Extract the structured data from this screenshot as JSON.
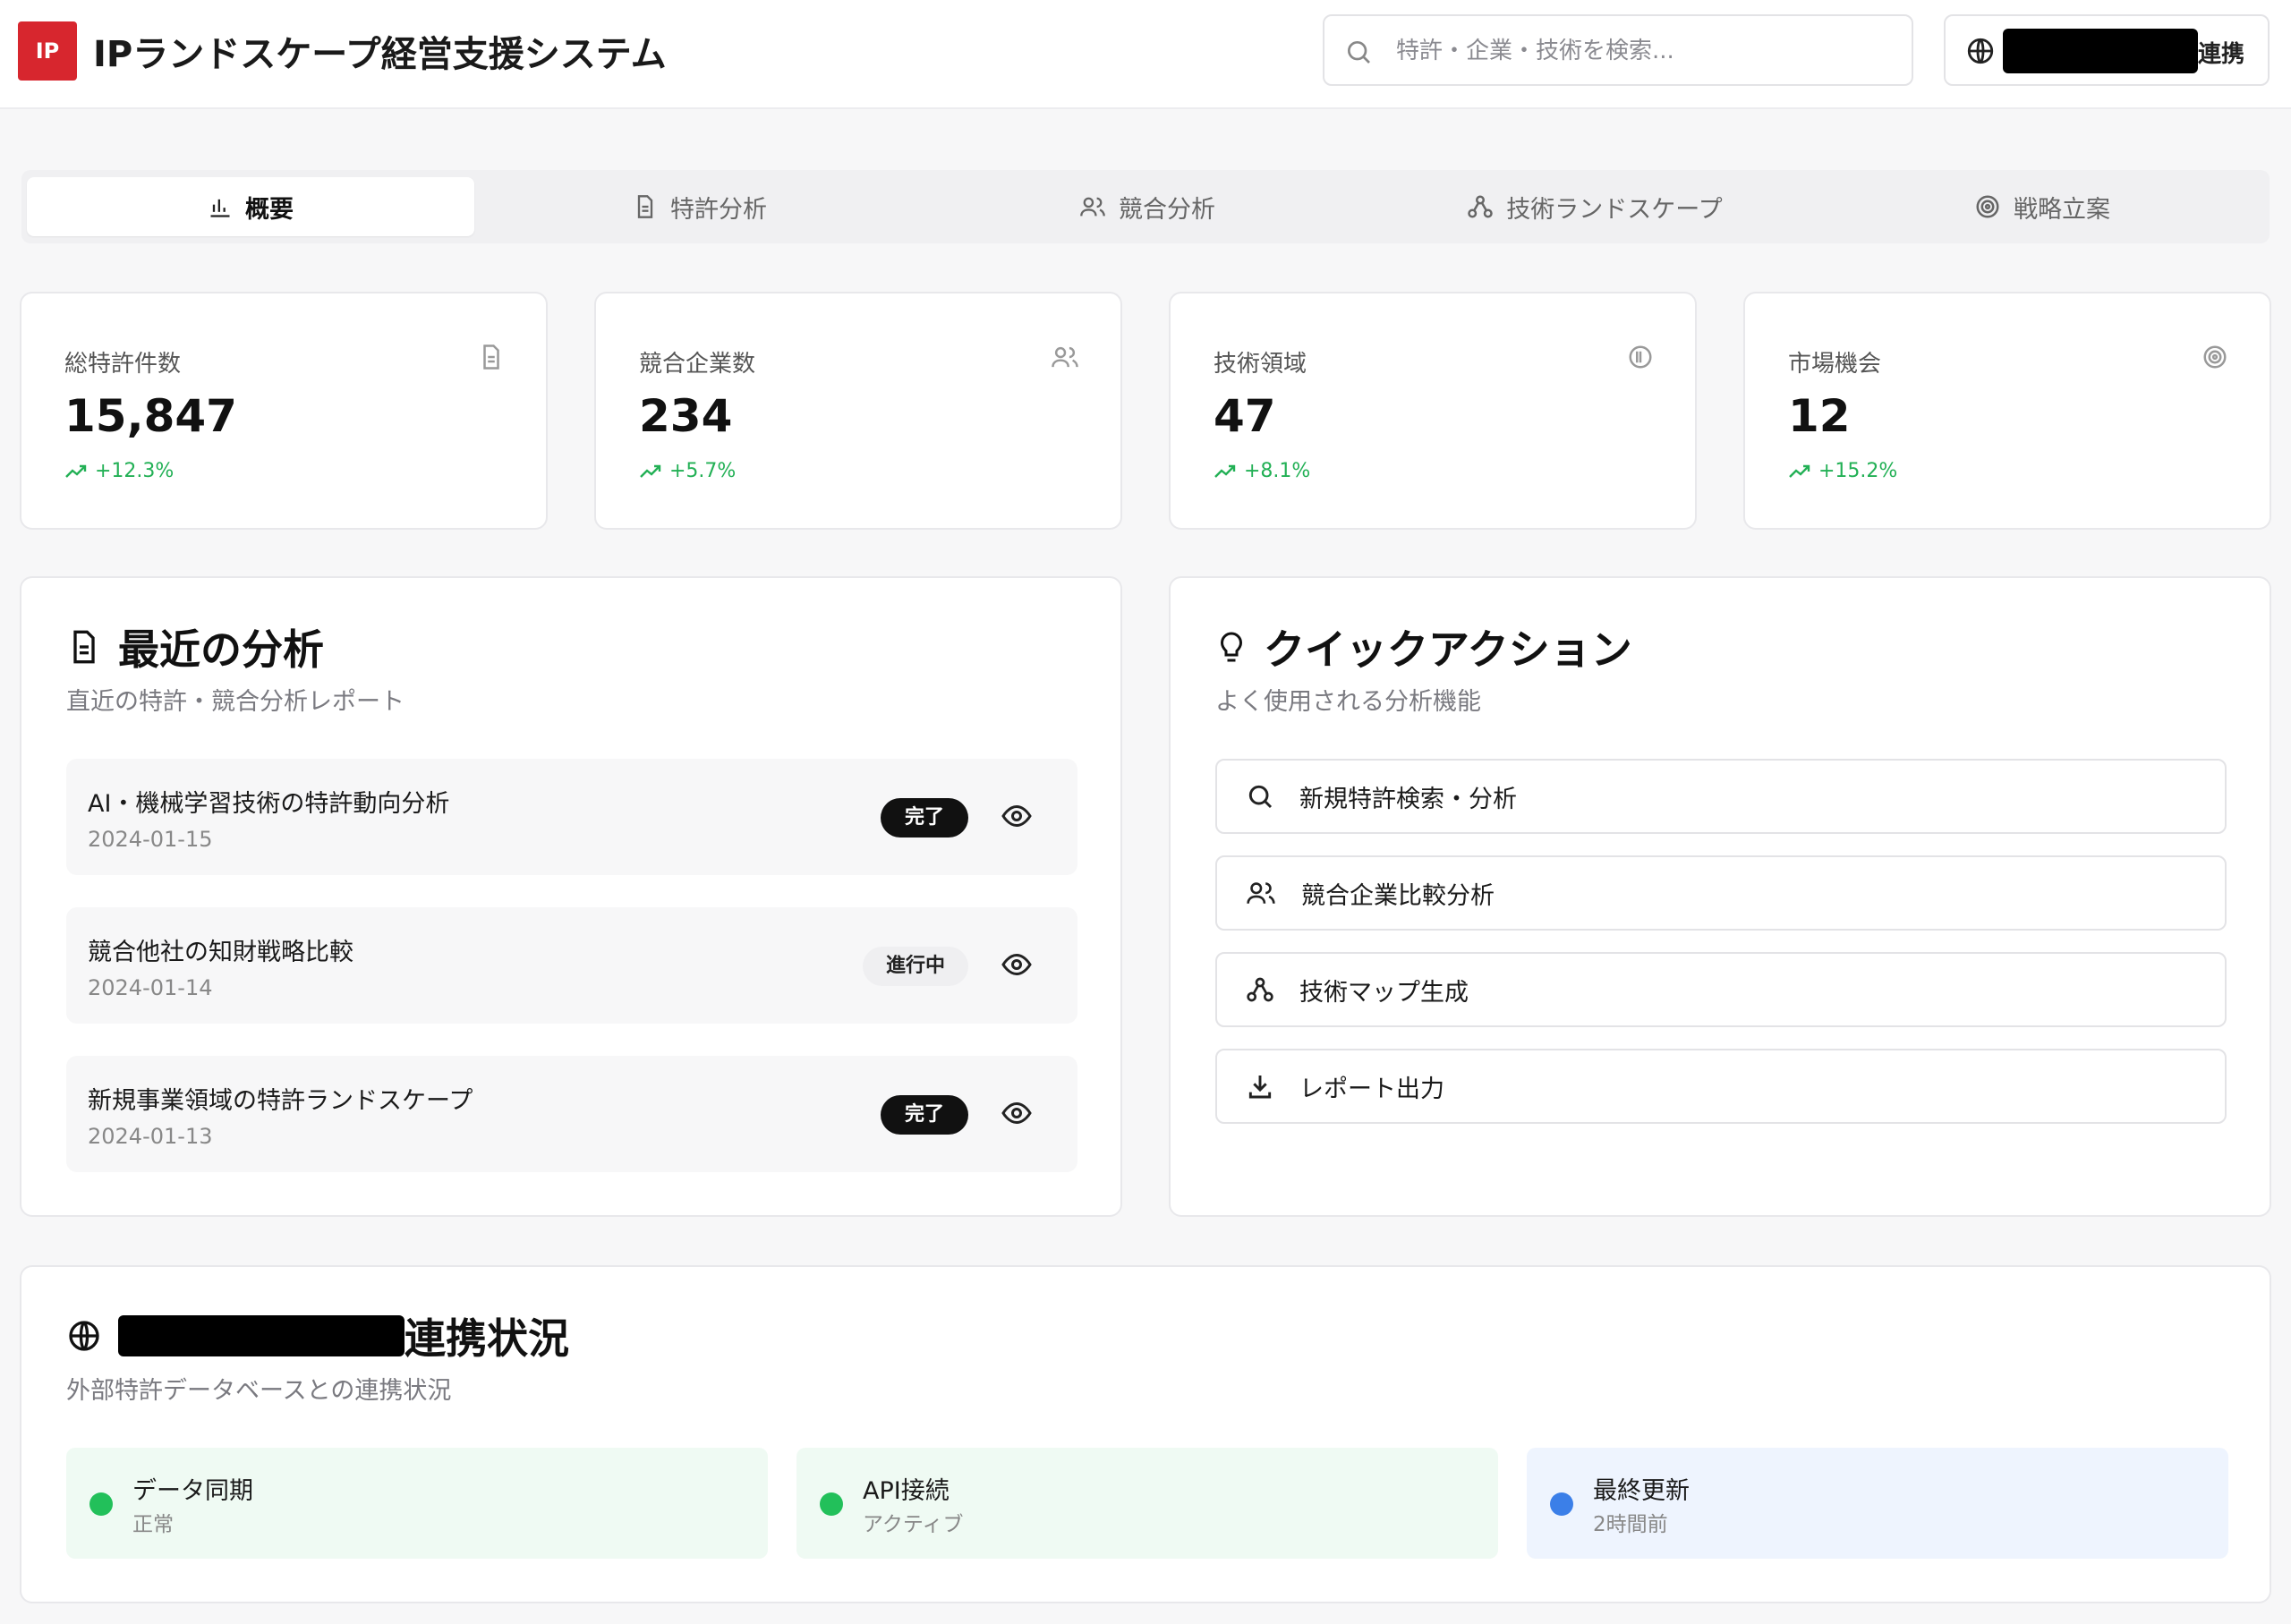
{
  "header": {
    "logo_text": "IP",
    "title": "IPランドスケープ経営支援システム",
    "search_placeholder": "特許・企業・技術を検索...",
    "connect_label": "連携"
  },
  "tabs": [
    {
      "label": "概要",
      "icon": "bar-chart-icon",
      "active": true
    },
    {
      "label": "特許分析",
      "icon": "document-icon",
      "active": false
    },
    {
      "label": "競合分析",
      "icon": "users-icon",
      "active": false
    },
    {
      "label": "技術ランドスケープ",
      "icon": "network-icon",
      "active": false
    },
    {
      "label": "戦略立案",
      "icon": "target-icon",
      "active": false
    }
  ],
  "stats": [
    {
      "label": "総特許件数",
      "value": "15,847",
      "trend": "+12.3%",
      "icon": "document-icon"
    },
    {
      "label": "競合企業数",
      "value": "234",
      "trend": "+5.7%",
      "icon": "users-icon"
    },
    {
      "label": "技術領域",
      "value": "47",
      "trend": "+8.1%",
      "icon": "info-icon"
    },
    {
      "label": "市場機会",
      "value": "12",
      "trend": "+15.2%",
      "icon": "target-icon"
    }
  ],
  "recent": {
    "title": "最近の分析",
    "subtitle": "直近の特許・競合分析レポート",
    "items": [
      {
        "name": "AI・機械学習技術の特許動向分析",
        "date": "2024-01-15",
        "status": "完了",
        "status_type": "done"
      },
      {
        "name": "競合他社の知財戦略比較",
        "date": "2024-01-14",
        "status": "進行中",
        "status_type": "progress"
      },
      {
        "name": "新規事業領域の特許ランドスケープ",
        "date": "2024-01-13",
        "status": "完了",
        "status_type": "done"
      }
    ]
  },
  "quick": {
    "title": "クイックアクション",
    "subtitle": "よく使用される分析機能",
    "actions": [
      {
        "label": "新規特許検索・分析",
        "icon": "search-icon"
      },
      {
        "label": "競合企業比較分析",
        "icon": "users-icon"
      },
      {
        "label": "技術マップ生成",
        "icon": "network-icon"
      },
      {
        "label": "レポート出力",
        "icon": "download-icon"
      }
    ]
  },
  "integration": {
    "title_suffix": "連携状況",
    "subtitle": "外部特許データベースとの連携状況",
    "statuses": [
      {
        "title": "データ同期",
        "value": "正常",
        "color": "#22c05a"
      },
      {
        "title": "API接続",
        "value": "アクティブ",
        "color": "#22c05a"
      },
      {
        "title": "最終更新",
        "value": "2時間前",
        "color": "#3b7fe8"
      }
    ]
  },
  "colors": {
    "brand_red": "#d7262e",
    "trend_green": "#22b055",
    "status_green": "#22c05a",
    "status_blue": "#3b7fe8"
  }
}
